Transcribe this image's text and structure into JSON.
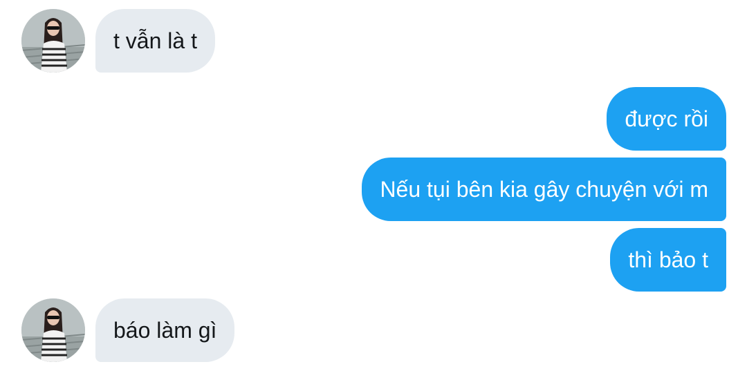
{
  "conversation": {
    "messages": [
      {
        "sender": "them",
        "text": "t vẫn là t"
      },
      {
        "sender": "me",
        "text": "được rồi"
      },
      {
        "sender": "me",
        "text": "Nếu tụi bên kia gây chuyện với m"
      },
      {
        "sender": "me",
        "text": "thì bảo t"
      },
      {
        "sender": "them",
        "text": "báo làm gì"
      }
    ]
  },
  "colors": {
    "incoming_bubble": "#e6ebf0",
    "outgoing_bubble": "#1da1f2",
    "incoming_text": "#14171a",
    "outgoing_text": "#ffffff"
  },
  "icons": {
    "avatar": "contact-avatar-photo"
  }
}
